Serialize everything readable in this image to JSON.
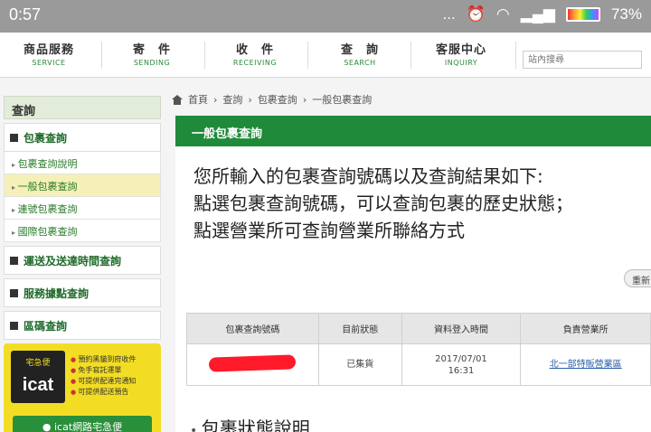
{
  "status": {
    "time": "0:57",
    "dots": "...",
    "battery": "73%"
  },
  "nav": [
    {
      "zh": "商品服務",
      "en": "SERVICE"
    },
    {
      "zh": "寄　件",
      "en": "SENDING"
    },
    {
      "zh": "收　件",
      "en": "RECEIVING"
    },
    {
      "zh": "查　詢",
      "en": "SEARCH"
    },
    {
      "zh": "客服中心",
      "en": "INQUIRY"
    }
  ],
  "search": {
    "placeholder": "站內搜尋"
  },
  "sidebar": {
    "title": "查詢",
    "group1": "包裹查詢",
    "items": [
      "包裹查詢說明",
      "一般包裹查詢",
      "連號包裹查詢",
      "國際包裹查詢"
    ],
    "group2": "運送及送達時間查詢",
    "group3": "服務據點查詢",
    "group4": "區碼查詢"
  },
  "promo": {
    "brand": "宅急便",
    "logo_text": "icat",
    "bullets": [
      "預約黑貓到府收件",
      "免手寫託運單",
      "可提供配達完通知",
      "可提供配送預告"
    ],
    "button": "icat網路宅急便"
  },
  "breadcrumb": [
    "首頁",
    "查詢",
    "包裹查詢",
    "一般包裹查詢"
  ],
  "panel": {
    "title": "一般包裹查詢",
    "intro": [
      "您所輸入的包裹查詢號碼以及查詢結果如下:",
      "點選包裹查詢號碼，可以查詢包裹的歷史狀態；",
      "點選營業所可查詢營業所聯絡方式"
    ],
    "reset": "重新"
  },
  "table": {
    "headers": [
      "包裹查詢號碼",
      "目前狀態",
      "資料登入時間",
      "負責營業所"
    ],
    "row": {
      "status": "已集貨",
      "date": "2017/07/01",
      "time": "16:31",
      "office": "北一部特販營業區"
    }
  },
  "section_title": "包裹狀態說明"
}
